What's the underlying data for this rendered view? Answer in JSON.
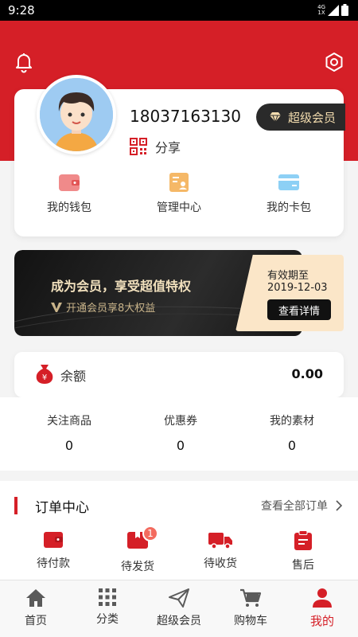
{
  "status_bar": {
    "time": "9:28",
    "network_top": "4G",
    "network_bottom": "1X"
  },
  "header": {
    "left_icon": "bell-icon",
    "right_icon": "gear-icon",
    "color": "#d51f27"
  },
  "profile": {
    "phone": "18037163130",
    "share_label": "分享",
    "vip_badge_label": "超级会员",
    "quick_actions": [
      {
        "label": "我的钱包",
        "icon": "wallet-icon"
      },
      {
        "label": "管理中心",
        "icon": "management-icon"
      },
      {
        "label": "我的卡包",
        "icon": "card-icon"
      }
    ]
  },
  "vip_banner": {
    "title": "成为会员，享受超值特权",
    "subtitle": "开通会员享8大权益",
    "expiry_label": "有效期至",
    "expiry_date": "2019-12-03",
    "detail_button": "查看详情"
  },
  "balance": {
    "label": "余额",
    "value": "0.00"
  },
  "stats": [
    {
      "label": "关注商品",
      "value": "0"
    },
    {
      "label": "优惠券",
      "value": "0"
    },
    {
      "label": "我的素材",
      "value": "0"
    }
  ],
  "orders": {
    "title": "订单中心",
    "view_all": "查看全部订单",
    "items": [
      {
        "label": "待付款",
        "icon": "wallet-icon"
      },
      {
        "label": "待发货",
        "icon": "package-icon",
        "badge": "1"
      },
      {
        "label": "待收货",
        "icon": "truck-icon"
      },
      {
        "label": "售后",
        "icon": "clipboard-icon"
      }
    ]
  },
  "tabbar": [
    {
      "label": "首页",
      "icon": "home-icon"
    },
    {
      "label": "分类",
      "icon": "grid-icon"
    },
    {
      "label": "超级会员",
      "icon": "send-icon"
    },
    {
      "label": "购物车",
      "icon": "cart-icon"
    },
    {
      "label": "我的",
      "icon": "person-icon",
      "active": true
    }
  ],
  "colors": {
    "accent": "#d51f27",
    "vip_gold": "#f3dcae",
    "tab_icon": "#5a5a5a"
  }
}
